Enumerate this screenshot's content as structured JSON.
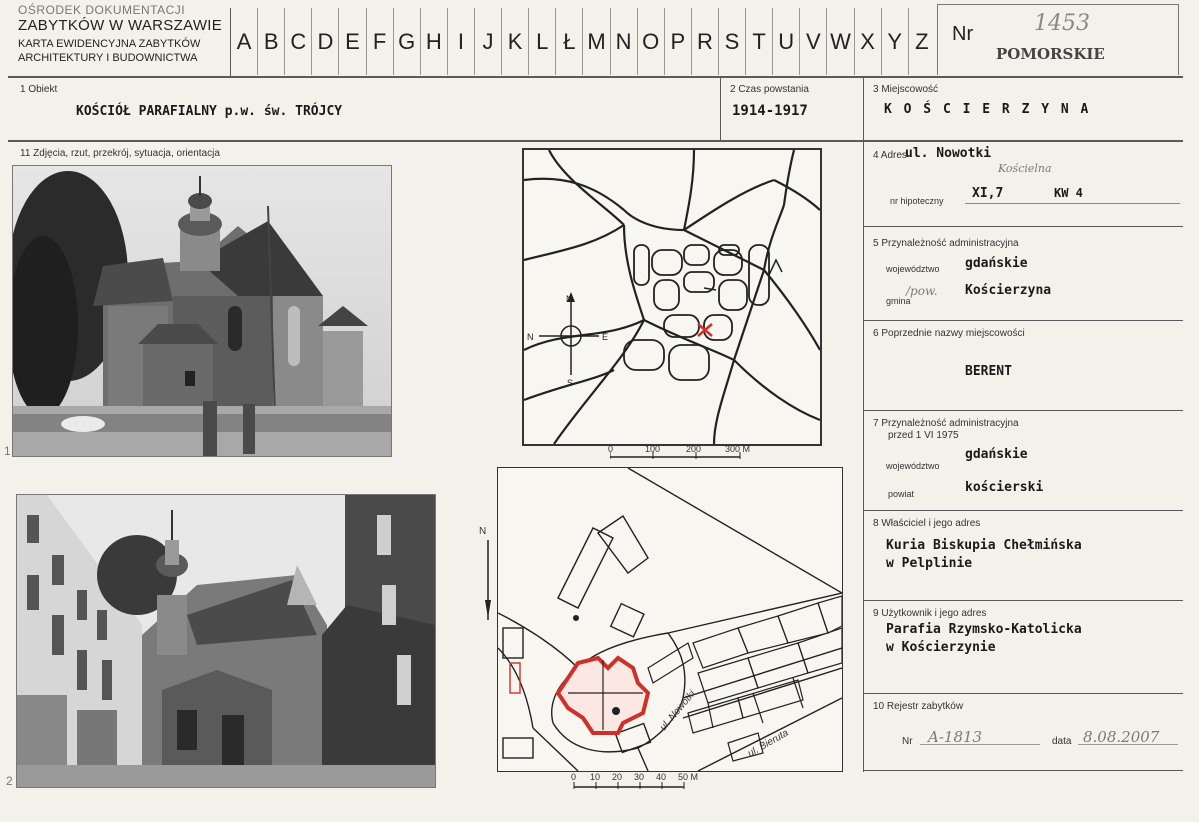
{
  "header": {
    "line1": "OŚRODEK DOKUMENTACJI",
    "line2": "ZABYTKÓW W WARSZAWIE",
    "line3": "KARTA EWIDENCYJNA ZABYTKÓW",
    "line4": "ARCHITEKTURY I BUDOWNICTWA"
  },
  "alphabet": [
    "A",
    "B",
    "C",
    "D",
    "E",
    "F",
    "G",
    "H",
    "I",
    "J",
    "K",
    "L",
    "Ł",
    "M",
    "N",
    "O",
    "P",
    "R",
    "S",
    "T",
    "U",
    "V",
    "W",
    "X",
    "Y",
    "Z"
  ],
  "nr": {
    "label": "Nr",
    "number": "1453",
    "region": "POMORSKIE"
  },
  "fields": {
    "obiekt_label": "1 Obiekt",
    "obiekt_value": "KOŚCIÓŁ PARAFIALNY p.w. św. TRÓJCY",
    "czas_label": "2 Czas powstania",
    "czas_value": "1914-1917",
    "miejscowosc_label": "3 Miejscowość",
    "miejscowosc_value": "K O Ś C I E R Z Y N A",
    "zdjecia_label": "11 Zdjęcia, rzut, przekrój, sytuacja, orientacja",
    "adres_label": "4 Adres",
    "adres_value": "ul. Nowotki",
    "adres_hand": "Kościelna",
    "hipoteczny_label": "nr hipoteczny",
    "hipoteczny_value1": "XI,7",
    "hipoteczny_value2": "KW 4",
    "przyn_label": "5 Przynależność administracyjna",
    "woj_label": "województwo",
    "woj_value": "gdańskie",
    "gmina_label": "gmina",
    "gmina_hand": "/pow.",
    "gmina_value": "Kościerzyna",
    "poprzednie_label": "6 Poprzednie nazwy miejscowości",
    "poprzednie_value": "BERENT",
    "przyn75_label1": "7 Przynależność administracyjna",
    "przyn75_label2": "przed 1 VI 1975",
    "woj75_label": "województwo",
    "woj75_value": "gdańskie",
    "powiat_label": "powiat",
    "powiat_value": "kościerski",
    "wlasciciel_label": "8 Właściciel i jego adres",
    "wlasciciel_value1": "Kuria Biskupia Chełmińska",
    "wlasciciel_value2": "w Pelplinie",
    "uzytkownik_label": "9 Użytkownik i jego adres",
    "uzytkownik_value1": "Parafia Rzymsko-Katolicka",
    "uzytkownik_value2": "w Kościerzynie",
    "rejestr_label": "10 Rejestr zabytków",
    "rejestr_nr_label": "Nr",
    "rejestr_nr_value": "A-1813",
    "rejestr_data_label": "data",
    "rejestr_data_value": "8.08.2007"
  },
  "photos": {
    "photo1_number": "1",
    "photo2_number": "2"
  },
  "map1": {
    "compass_n": "N",
    "compass_s": "S",
    "compass_e": "E",
    "compass_w": "N",
    "scale": [
      "0",
      "100",
      "200",
      "300 M"
    ]
  },
  "map2": {
    "north": "N",
    "street1": "ul. Nowotki",
    "street2": "ul. Bieruta",
    "scale": [
      "0",
      "10",
      "20",
      "30",
      "40",
      "50 M"
    ]
  },
  "colors": {
    "line": "#5a5a5a",
    "red": "#d0302a",
    "paper": "#f4f1ea"
  }
}
